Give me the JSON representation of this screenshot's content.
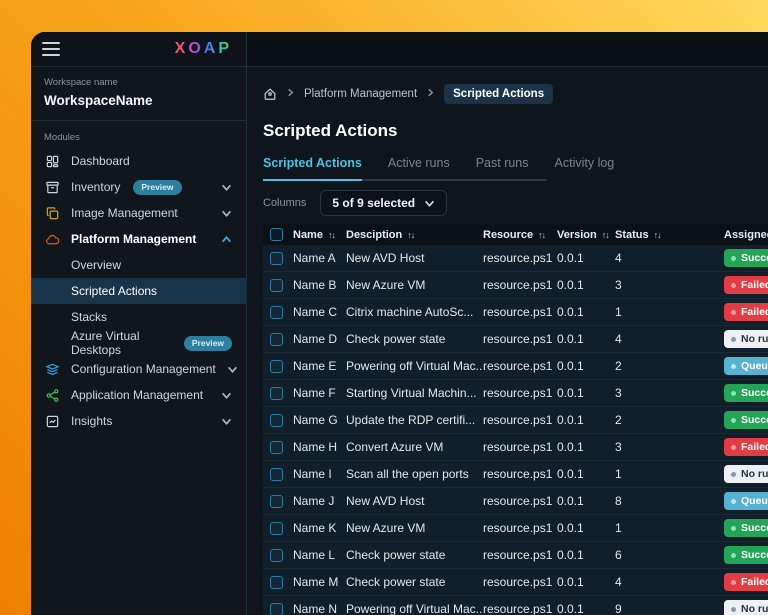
{
  "logo_text": "XOAP",
  "colors": {
    "accent_teal": "#4cc3e0",
    "success_bg": "#24a457",
    "failed_bg": "#e23d45",
    "no_runs_bg": "#edf1f4",
    "queued_bg": "#57b1d0",
    "preview_badge_bg": "#2d7f9f",
    "selected_item_bg": "#17344a"
  },
  "sidebar": {
    "workspace_label": "Workspace name",
    "workspace_name": "WorkspaceName",
    "modules_label": "Modules",
    "preview_badge_label": "Preview",
    "modules": [
      {
        "label": "Dashboard",
        "icon": "dashboard"
      },
      {
        "label": "Inventory",
        "icon": "inventory",
        "preview": true,
        "chevron": "down"
      },
      {
        "label": "Image Management",
        "icon": "image-management",
        "chevron": "down"
      },
      {
        "label": "Platform Management",
        "icon": "platform-management",
        "chevron": "up",
        "bold": true,
        "children": [
          {
            "label": "Overview"
          },
          {
            "label": "Scripted Actions",
            "active": true
          },
          {
            "label": "Stacks"
          },
          {
            "label": "Azure Virtual Desktops",
            "preview": true
          }
        ]
      },
      {
        "label": "Configuration Management",
        "icon": "configuration-management",
        "chevron": "down"
      },
      {
        "label": "Application Management",
        "icon": "application-management",
        "chevron": "down"
      },
      {
        "label": "Insights",
        "icon": "insights",
        "chevron": "down"
      }
    ]
  },
  "breadcrumb": {
    "parent": "Platform Management",
    "current": "Scripted Actions"
  },
  "page": {
    "title": "Scripted Actions",
    "tabs": [
      {
        "label": "Scripted Actions",
        "active": true
      },
      {
        "label": "Active runs",
        "active": false
      },
      {
        "label": "Past runs",
        "active": false
      },
      {
        "label": "Activity log",
        "active": false
      }
    ]
  },
  "toolbar": {
    "columns_label": "Columns",
    "columns_value": "5 of 9 selected"
  },
  "table": {
    "headers": [
      {
        "label": "Name",
        "sortable": true
      },
      {
        "label": "Desciption",
        "sortable": true
      },
      {
        "label": "Resource",
        "sortable": true
      },
      {
        "label": "Version",
        "sortable": true
      },
      {
        "label": "Status",
        "sortable": true
      },
      {
        "label": "Assigned S",
        "sortable": false
      }
    ],
    "sort_glyph": "↑↓",
    "rows": [
      {
        "name": "Name A",
        "description": "New AVD Host",
        "resource": "resource.ps1",
        "version": "0.0.1",
        "status": "4",
        "assigned": "Success",
        "assigned_kind": "success"
      },
      {
        "name": "Name B",
        "description": "New Azure VM",
        "resource": "resource.ps1",
        "version": "0.0.1",
        "status": "3",
        "assigned": "Failed",
        "assigned_kind": "failed"
      },
      {
        "name": "Name C",
        "description": "Citrix machine AutoSc...",
        "resource": "resource.ps1",
        "version": "0.0.1",
        "status": "1",
        "assigned": "Failed",
        "assigned_kind": "failed"
      },
      {
        "name": "Name D",
        "description": "Check power state",
        "resource": "resource.ps1",
        "version": "0.0.1",
        "status": "4",
        "assigned": "No runs",
        "assigned_kind": "no_runs"
      },
      {
        "name": "Name E",
        "description": "Powering off Virtual Mac...",
        "resource": "resource.ps1",
        "version": "0.0.1",
        "status": "2",
        "assigned": "Queued",
        "assigned_kind": "queued"
      },
      {
        "name": "Name F",
        "description": "Starting Virtual Machin...",
        "resource": "resource.ps1",
        "version": "0.0.1",
        "status": "3",
        "assigned": "Success",
        "assigned_kind": "success"
      },
      {
        "name": "Name G",
        "description": "Update the RDP certifi...",
        "resource": "resource.ps1",
        "version": "0.0.1",
        "status": "2",
        "assigned": "Success",
        "assigned_kind": "success"
      },
      {
        "name": "Name H",
        "description": "Convert Azure VM",
        "resource": "resource.ps1",
        "version": "0.0.1",
        "status": "3",
        "assigned": "Failed",
        "assigned_kind": "failed"
      },
      {
        "name": "Name I",
        "description": "Scan all the open ports",
        "resource": "resource.ps1",
        "version": "0.0.1",
        "status": "1",
        "assigned": "No runs",
        "assigned_kind": "no_runs"
      },
      {
        "name": "Name J",
        "description": "New AVD Host",
        "resource": "resource.ps1",
        "version": "0.0.1",
        "status": "8",
        "assigned": "Queued",
        "assigned_kind": "queued"
      },
      {
        "name": "Name K",
        "description": "New Azure VM",
        "resource": "resource.ps1",
        "version": "0.0.1",
        "status": "1",
        "assigned": "Success",
        "assigned_kind": "success"
      },
      {
        "name": "Name L",
        "description": "Check power state",
        "resource": "resource.ps1",
        "version": "0.0.1",
        "status": "6",
        "assigned": "Success",
        "assigned_kind": "success"
      },
      {
        "name": "Name M",
        "description": "Check power state",
        "resource": "resource.ps1",
        "version": "0.0.1",
        "status": "4",
        "assigned": "Failed",
        "assigned_kind": "failed"
      },
      {
        "name": "Name N",
        "description": "Powering off Virtual Mac...",
        "resource": "resource.ps1",
        "version": "0.0.1",
        "status": "9",
        "assigned": "No runs",
        "assigned_kind": "no_runs"
      }
    ]
  }
}
